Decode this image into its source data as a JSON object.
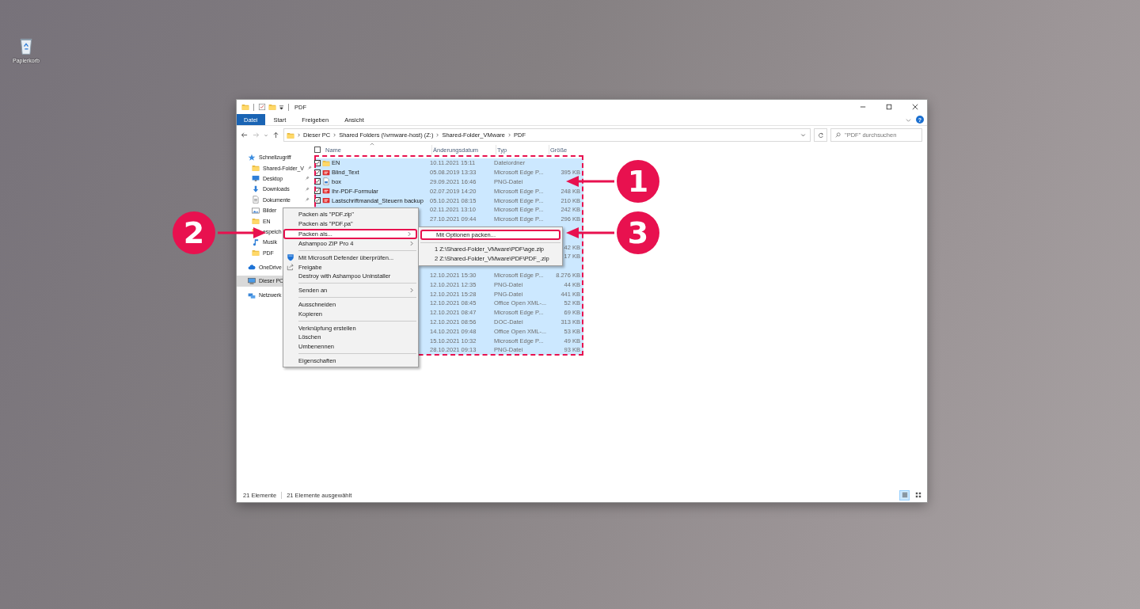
{
  "desktop_icons": [
    {
      "label": "Papierkorb"
    }
  ],
  "window": {
    "title": "PDF"
  },
  "ribbon": {
    "tabs": [
      {
        "label": "Datei",
        "selected": true
      },
      {
        "label": "Start",
        "selected": false
      },
      {
        "label": "Freigeben",
        "selected": false
      },
      {
        "label": "Ansicht",
        "selected": false
      }
    ],
    "help": "?"
  },
  "address_bar": {
    "path": [
      "Dieser PC",
      "Shared Folders (\\\\vmware-host) (Z:)",
      "Shared-Folder_VMware",
      "PDF"
    ]
  },
  "search": {
    "placeholder": "\"PDF\" durchsuchen"
  },
  "sidebar": {
    "items": [
      {
        "label": "Schnellzugriff",
        "kind": "star",
        "pinned": false,
        "selected": false,
        "gap": false
      },
      {
        "label": "Shared-Folder_V",
        "kind": "folder",
        "pinned": true,
        "selected": false,
        "gap": false
      },
      {
        "label": "Desktop",
        "kind": "desktop",
        "pinned": true,
        "selected": false,
        "gap": false
      },
      {
        "label": "Downloads",
        "kind": "download",
        "pinned": true,
        "selected": false,
        "gap": false
      },
      {
        "label": "Dokumente",
        "kind": "document",
        "pinned": true,
        "selected": false,
        "gap": false
      },
      {
        "label": "Bilder",
        "kind": "pictures",
        "selected": false,
        "gap": false
      },
      {
        "label": "EN",
        "kind": "folder",
        "selected": false,
        "gap": false
      },
      {
        "label": "espeich",
        "kind": "folder",
        "selected": false,
        "gap": false
      },
      {
        "label": "Musik",
        "kind": "music",
        "selected": false,
        "gap": false
      },
      {
        "label": "PDF",
        "kind": "folder",
        "selected": false,
        "gap": false
      },
      {
        "label": "OneDrive",
        "kind": "cloud",
        "selected": false,
        "gap": true
      },
      {
        "label": "Dieser PC",
        "kind": "pc",
        "selected": true,
        "gap": true
      },
      {
        "label": "Netzwerk",
        "kind": "network",
        "selected": false,
        "gap": true
      }
    ]
  },
  "files": {
    "select_all": {
      "checked": false
    },
    "columns": [
      "Name",
      "Änderungsdatum",
      "Typ",
      "Größe"
    ],
    "rows": [
      {
        "name": "EN",
        "kind": "folder",
        "date": "10.11.2021 15:11",
        "type": "Dateiordner",
        "selected": true,
        "checked": true
      },
      {
        "name": "Blind_Text",
        "kind": "pdf",
        "date": "05.08.2019 13:33",
        "type": "Microsoft Edge P...",
        "size": "395 KB",
        "selected": true,
        "checked": true
      },
      {
        "name": "box",
        "kind": "png",
        "date": "29.09.2021 16:46",
        "type": "PNG-Datei",
        "selected": true,
        "checked": true
      },
      {
        "name": "Ihr-PDF-Formular",
        "kind": "pdf",
        "date": "02.07.2019 14:20",
        "type": "Microsoft Edge P...",
        "size": "248 KB",
        "selected": true,
        "checked": true
      },
      {
        "name": "Lastschriftmandat_Steuern backup",
        "kind": "pdf",
        "date": "05.10.2021 08:15",
        "type": "Microsoft Edge P...",
        "size": "210 KB",
        "selected": true,
        "checked": true
      },
      {
        "date": "02.11.2021 13:10",
        "type": "Microsoft Edge P...",
        "size": "242 KB",
        "selected": true
      },
      {
        "date": "27.10.2021 09:44",
        "type": "Microsoft Edge P...",
        "size": "296 KB",
        "selected": true
      },
      {
        "selected": true
      },
      {
        "selected": true
      },
      {
        "size": "42 KB",
        "selected": true
      },
      {
        "size": "17 KB",
        "selected": true
      },
      {
        "selected": true
      },
      {
        "date": "12.10.2021 15:30",
        "type": "Microsoft Edge P...",
        "size": "8.276 KB",
        "selected": true
      },
      {
        "date": "12.10.2021 12:35",
        "type": "PNG-Datei",
        "size": "44 KB",
        "selected": true
      },
      {
        "date": "12.10.2021 15:28",
        "type": "PNG-Datei",
        "size": "441 KB",
        "selected": true
      },
      {
        "date": "12.10.2021 08:45",
        "type": "Office Open XML-...",
        "size": "52 KB",
        "selected": true
      },
      {
        "date": "12.10.2021 08:47",
        "type": "Microsoft Edge P...",
        "size": "69 KB",
        "selected": true
      },
      {
        "date": "12.10.2021 08:56",
        "type": "DOC-Datei",
        "size": "313 KB",
        "selected": true
      },
      {
        "date": "14.10.2021 09:48",
        "type": "Office Open XML-...",
        "size": "53 KB",
        "selected": true
      },
      {
        "date": "15.10.2021 10:32",
        "type": "Microsoft Edge P...",
        "size": "49 KB",
        "selected": true
      },
      {
        "date": "28.10.2021 09:13",
        "type": "PNG-Datei",
        "size": "93 KB",
        "selected": true
      }
    ]
  },
  "context_menu": {
    "items": [
      {
        "kind": "item",
        "label": "Packen als \"PDF.zip\"",
        "submenu": false,
        "highlighted": false
      },
      {
        "kind": "item",
        "label": "Packen als \"PDF.pa\"",
        "submenu": false,
        "highlighted": false
      },
      {
        "kind": "item",
        "label": "Packen als...",
        "submenu": true,
        "highlighted": true
      },
      {
        "kind": "item",
        "label": "Ashampoo ZIP Pro 4",
        "submenu": true,
        "highlighted": false
      },
      {
        "kind": "separator"
      },
      {
        "kind": "shield",
        "label": "Mit Microsoft Defender überprüfen...",
        "submenu": false,
        "highlighted": false
      },
      {
        "kind": "share",
        "label": "Freigabe",
        "submenu": false,
        "highlighted": false
      },
      {
        "kind": "item",
        "label": "Destroy with Ashampoo Uninstaller",
        "submenu": false,
        "highlighted": false
      },
      {
        "kind": "separator"
      },
      {
        "kind": "item",
        "label": "Senden an",
        "submenu": true,
        "highlighted": false
      },
      {
        "kind": "separator"
      },
      {
        "kind": "item",
        "label": "Ausschneiden",
        "submenu": false,
        "highlighted": false
      },
      {
        "kind": "item",
        "label": "Kopieren",
        "submenu": false,
        "highlighted": false
      },
      {
        "kind": "separator"
      },
      {
        "kind": "item",
        "label": "Verknüpfung erstellen",
        "submenu": false,
        "highlighted": false
      },
      {
        "kind": "item",
        "label": "Löschen",
        "submenu": false,
        "highlighted": false
      },
      {
        "kind": "item",
        "label": "Umbenennen",
        "submenu": false,
        "highlighted": false
      },
      {
        "kind": "separator"
      },
      {
        "kind": "item",
        "label": "Eigenschaften",
        "submenu": false,
        "highlighted": false
      }
    ]
  },
  "submenu": {
    "items": [
      {
        "kind": "item",
        "label": "Mit Optionen packen...",
        "highlighted": true
      },
      {
        "kind": "separator"
      },
      {
        "kind": "item",
        "label": "1 Z:\\Shared-Folder_VMware\\PDF\\age.zip",
        "highlighted": false
      },
      {
        "kind": "item",
        "label": "2 Z:\\Shared-Folder_VMware\\PDF\\PDF_.zip",
        "highlighted": false
      }
    ]
  },
  "status_bar": {
    "count": "21 Elemente",
    "selection": "21 Elemente ausgewählt",
    "views": [
      {
        "kind": "details",
        "selected": true
      },
      {
        "kind": "large-icons",
        "selected": false
      }
    ]
  },
  "callouts": [
    {
      "number": "1",
      "kind": "arrow-left"
    },
    {
      "number": "2",
      "kind": "arrow-right"
    },
    {
      "number": "3",
      "kind": "arrow-left"
    }
  ]
}
